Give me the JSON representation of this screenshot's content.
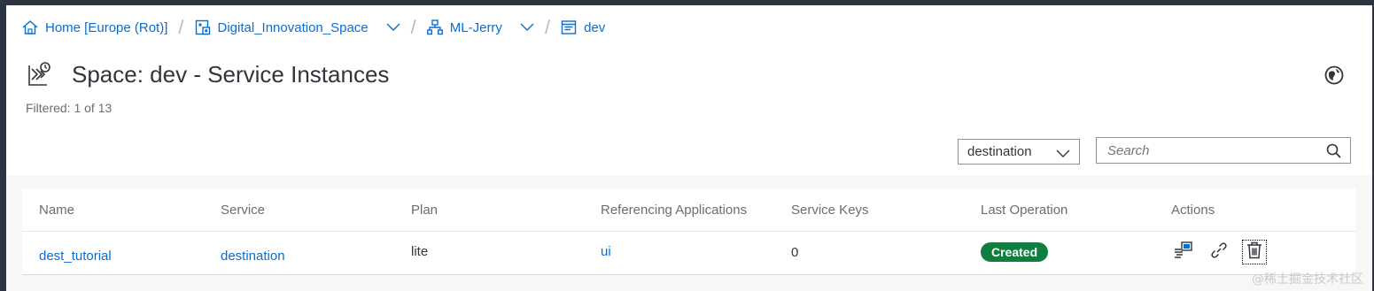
{
  "breadcrumb": {
    "home": "Home [Europe (Rot)]",
    "subaccount": "Digital_Innovation_Space",
    "org": "ML-Jerry",
    "space": "dev"
  },
  "header": {
    "title": "Space: dev - Service Instances",
    "filtered": "Filtered: 1 of 13"
  },
  "toolbar": {
    "filter_value": "destination",
    "search_placeholder": "Search"
  },
  "table": {
    "columns": [
      "Name",
      "Service",
      "Plan",
      "Referencing Applications",
      "Service Keys",
      "Last Operation",
      "Actions"
    ],
    "rows": [
      {
        "name": "dest_tutorial",
        "service": "destination",
        "plan": "lite",
        "ref_apps": "ui",
        "service_keys": "0",
        "last_operation": "Created"
      }
    ]
  },
  "watermark": "@稀土掘金技术社区",
  "colors": {
    "link": "#0a6ed1",
    "success": "#107e3e",
    "text": "#32363a",
    "muted": "#6a6d70"
  },
  "icons": [
    "home-icon",
    "subaccount-icon",
    "org-icon",
    "space-icon",
    "service-instances-icon",
    "globe-icon",
    "search-icon",
    "service-keys-icon",
    "bind-icon",
    "delete-icon"
  ]
}
